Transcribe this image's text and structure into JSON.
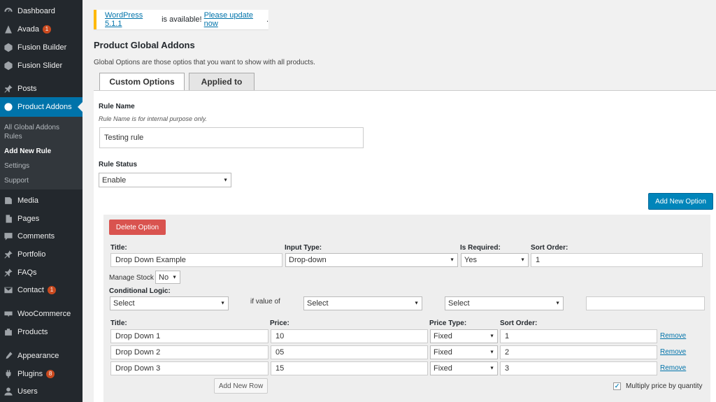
{
  "sidebar": {
    "items": [
      {
        "label": "Dashboard",
        "icon": "dashboard-icon"
      },
      {
        "label": "Avada",
        "icon": "avada-icon",
        "badge": "1"
      },
      {
        "label": "Fusion Builder",
        "icon": "fusion-builder-icon"
      },
      {
        "label": "Fusion Slider",
        "icon": "fusion-slider-icon"
      },
      {
        "label": "Posts",
        "icon": "pin-icon"
      },
      {
        "label": "Product Addons",
        "icon": "product-addons-icon"
      },
      {
        "label": "Media",
        "icon": "media-icon"
      },
      {
        "label": "Pages",
        "icon": "pages-icon"
      },
      {
        "label": "Comments",
        "icon": "comments-icon"
      },
      {
        "label": "Portfolio",
        "icon": "pin-icon"
      },
      {
        "label": "FAQs",
        "icon": "pin-icon"
      },
      {
        "label": "Contact",
        "icon": "mail-icon",
        "badge": "1"
      },
      {
        "label": "WooCommerce",
        "icon": "woocommerce-icon"
      },
      {
        "label": "Products",
        "icon": "products-icon"
      },
      {
        "label": "Appearance",
        "icon": "appearance-icon"
      },
      {
        "label": "Plugins",
        "icon": "plugins-icon",
        "badge": "8"
      },
      {
        "label": "Users",
        "icon": "users-icon"
      }
    ],
    "submenu": [
      {
        "label": "All Global Addons Rules"
      },
      {
        "label": "Add New Rule"
      },
      {
        "label": "Settings"
      },
      {
        "label": "Support"
      }
    ]
  },
  "notice": {
    "version_link": "WordPress 5.1.1",
    "middle": " is available! ",
    "update_link": "Please update now",
    "end": "."
  },
  "page": {
    "title": "Product Global Addons",
    "description": "Global Options are those optios that you want to show with all products."
  },
  "tabs": [
    {
      "label": "Custom Options"
    },
    {
      "label": "Applied to"
    }
  ],
  "rule": {
    "name_label": "Rule Name",
    "name_hint": "Rule Name is for internal purpose only.",
    "name_value": "Testing rule",
    "status_label": "Rule Status",
    "status_value": "Enable"
  },
  "buttons": {
    "add_new_option": "Add New Option",
    "delete_option": "Delete Option",
    "add_new_row": "Add New Row"
  },
  "option": {
    "title_label": "Title:",
    "title_value": "Drop Down Example",
    "input_type_label": "Input Type:",
    "input_type_value": "Drop-down",
    "required_label": "Is Required:",
    "required_value": "Yes",
    "sort_label": "Sort Order:",
    "sort_value": "1",
    "manage_stock_label": "Manage Stock",
    "manage_stock_value": "No",
    "conditional_label": "Conditional Logic:",
    "cond_select_1": "Select",
    "if_value_of": "if value of",
    "cond_select_2": "Select",
    "cond_select_3": "Select",
    "cond_value": ""
  },
  "rows_table": {
    "headers": {
      "title": "Title:",
      "price": "Price:",
      "price_type": "Price Type:",
      "sort": "Sort Order:"
    },
    "rows": [
      {
        "title": "Drop Down 1",
        "price": "10",
        "price_type": "Fixed",
        "sort": "1",
        "remove": "Remove"
      },
      {
        "title": "Drop Down 2",
        "price": "05",
        "price_type": "Fixed",
        "sort": "2",
        "remove": "Remove"
      },
      {
        "title": "Drop Down 3",
        "price": "15",
        "price_type": "Fixed",
        "sort": "3",
        "remove": "Remove"
      }
    ],
    "multiply_label": "Multiply price by quantity",
    "multiply_checked": true
  }
}
